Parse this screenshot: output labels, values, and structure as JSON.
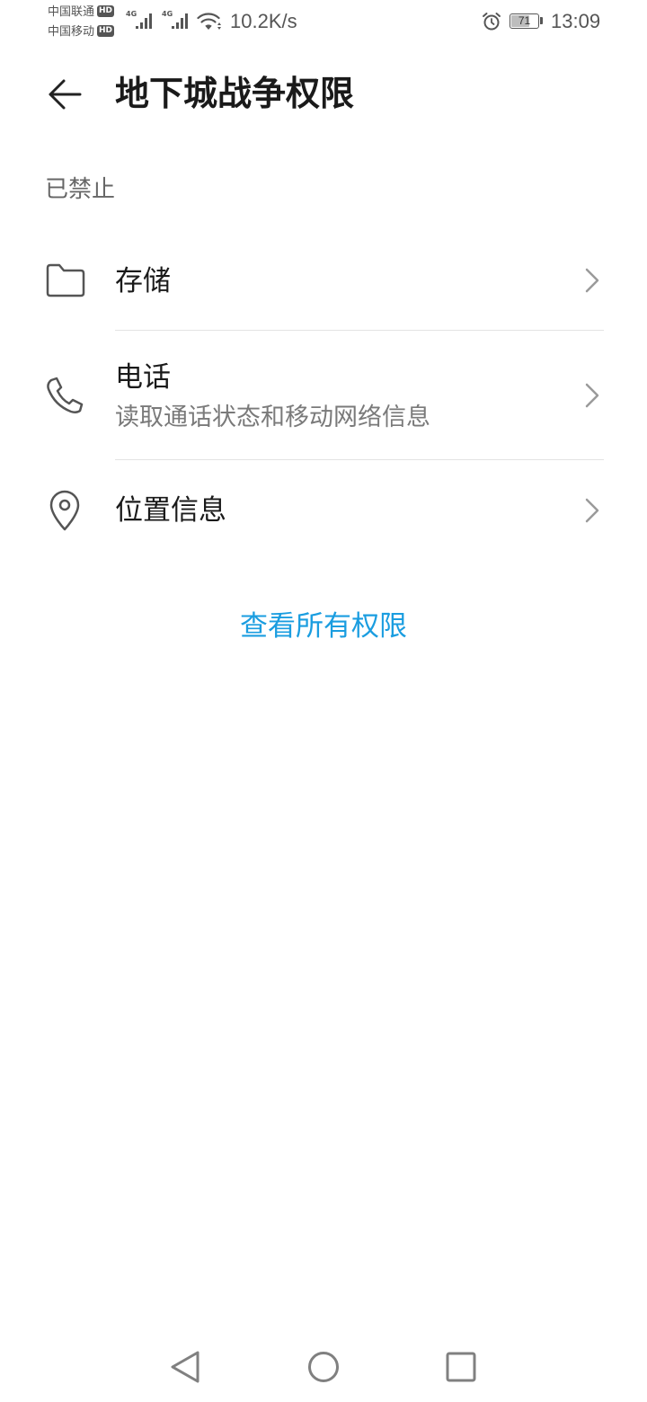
{
  "status_bar": {
    "sim1": {
      "carrier": "中国联通",
      "badge": "HD",
      "network": "4G"
    },
    "sim2": {
      "carrier": "中国移动",
      "badge": "HD",
      "network": "4G"
    },
    "net_speed": "10.2K/s",
    "battery_level": "71",
    "time": "13:09",
    "icons": [
      "signal-icon",
      "wifi-icon",
      "alarm-icon",
      "battery-icon"
    ]
  },
  "header": {
    "back_icon": "back-arrow-icon",
    "title": "地下城战争权限"
  },
  "denied_section": {
    "label": "已禁止",
    "chevron_icon": "chevron-right-icon",
    "items": [
      {
        "icon": "folder-icon",
        "label": "存储"
      },
      {
        "icon": "phone-icon",
        "label": "电话",
        "description": "读取通话状态和移动网络信息"
      },
      {
        "icon": "location-pin-icon",
        "label": "位置信息"
      }
    ]
  },
  "view_all_link": {
    "label": "查看所有权限"
  },
  "nav_bar": {
    "icons": [
      "back-triangle-icon",
      "home-circle-icon",
      "recents-square-icon"
    ]
  },
  "colors": {
    "accent": "#1a9de0",
    "text_primary": "#1a1a1a",
    "text_secondary": "#7a7a7a",
    "divider": "#e3e3e3",
    "background": "#ffffff"
  }
}
